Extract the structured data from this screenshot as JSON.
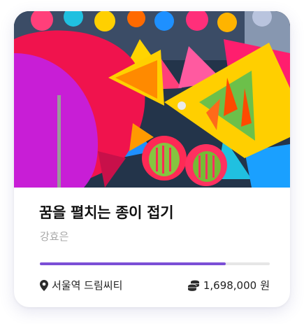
{
  "project": {
    "title": "꿈을 펼치는 종이 접기",
    "author": "강효은",
    "funding_progress_percent": 81,
    "location": "서울역 드림씨티",
    "funding_amount": "1,698,000",
    "currency": "원",
    "accent_color": "#7b4fd6"
  },
  "icons": {
    "location": "map-pin-icon",
    "funding": "coins-icon"
  },
  "hero_image": {
    "subject": "colorful paper origami fish decorations"
  }
}
